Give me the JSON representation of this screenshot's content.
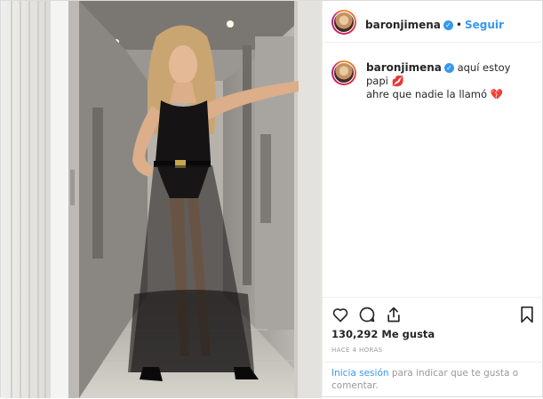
{
  "post": {
    "username": "baronjimena",
    "follow_label": "Seguir",
    "separator": "•",
    "caption_line1": "aquí estoy papi 💋",
    "caption_line2": "ahre que nadie la llamó 💔",
    "likes_count": "130,292",
    "likes_label": "Me gusta",
    "time_ago": "HACE 4 HORAS",
    "login_link": "Inicia sesión",
    "login_rest": "para indicar que te gusta o comentar."
  },
  "icons": {
    "verified": "✓",
    "like": "heart-icon",
    "comment": "comment-icon",
    "share": "share-icon",
    "save": "bookmark-icon"
  },
  "colors": {
    "accent": "#3897f0",
    "text": "#262626",
    "muted": "#999999",
    "border": "#efefef"
  }
}
